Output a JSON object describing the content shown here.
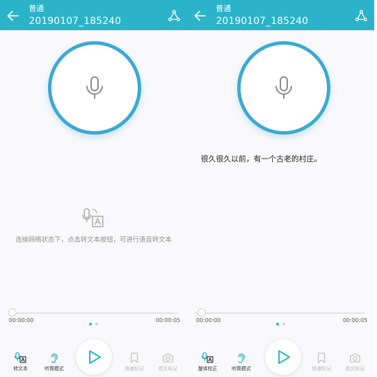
{
  "colors": {
    "header": "#2bb3c9",
    "ring": "#3aa9d3",
    "accent": "#2bb3c9",
    "background": "#f9f9fb",
    "disabled": "#b6b6b6"
  },
  "left": {
    "header": {
      "subtitle": "普通",
      "title": "20190107_185240"
    },
    "hint": "连接网络状态下，点击转文本按钮，可进行语音转文本",
    "time_start": "00:00:00",
    "time_end": "00:00:05",
    "toolbar": {
      "tool1": {
        "label": "转文本",
        "icon": "speech-to-text-icon"
      },
      "tool2": {
        "label": "听筒模式",
        "icon": "ear-icon"
      },
      "tool3": {
        "label": "快速标记",
        "icon": "bookmark-icon"
      },
      "tool4": {
        "label": "图文标记",
        "icon": "camera-icon"
      }
    }
  },
  "right": {
    "header": {
      "subtitle": "普通",
      "title": "20190107_185240"
    },
    "transcript": "很久很久以前，有一个古老的村庄。",
    "time_start": "00:00:00",
    "time_end": "00:00:05",
    "toolbar": {
      "tool1": {
        "label": "整体校正",
        "icon": "speech-to-text-icon"
      },
      "tool2": {
        "label": "听筒模式",
        "icon": "ear-icon"
      },
      "tool3": {
        "label": "快速标记",
        "icon": "bookmark-icon"
      },
      "tool4": {
        "label": "图文标记",
        "icon": "camera-icon"
      }
    }
  }
}
